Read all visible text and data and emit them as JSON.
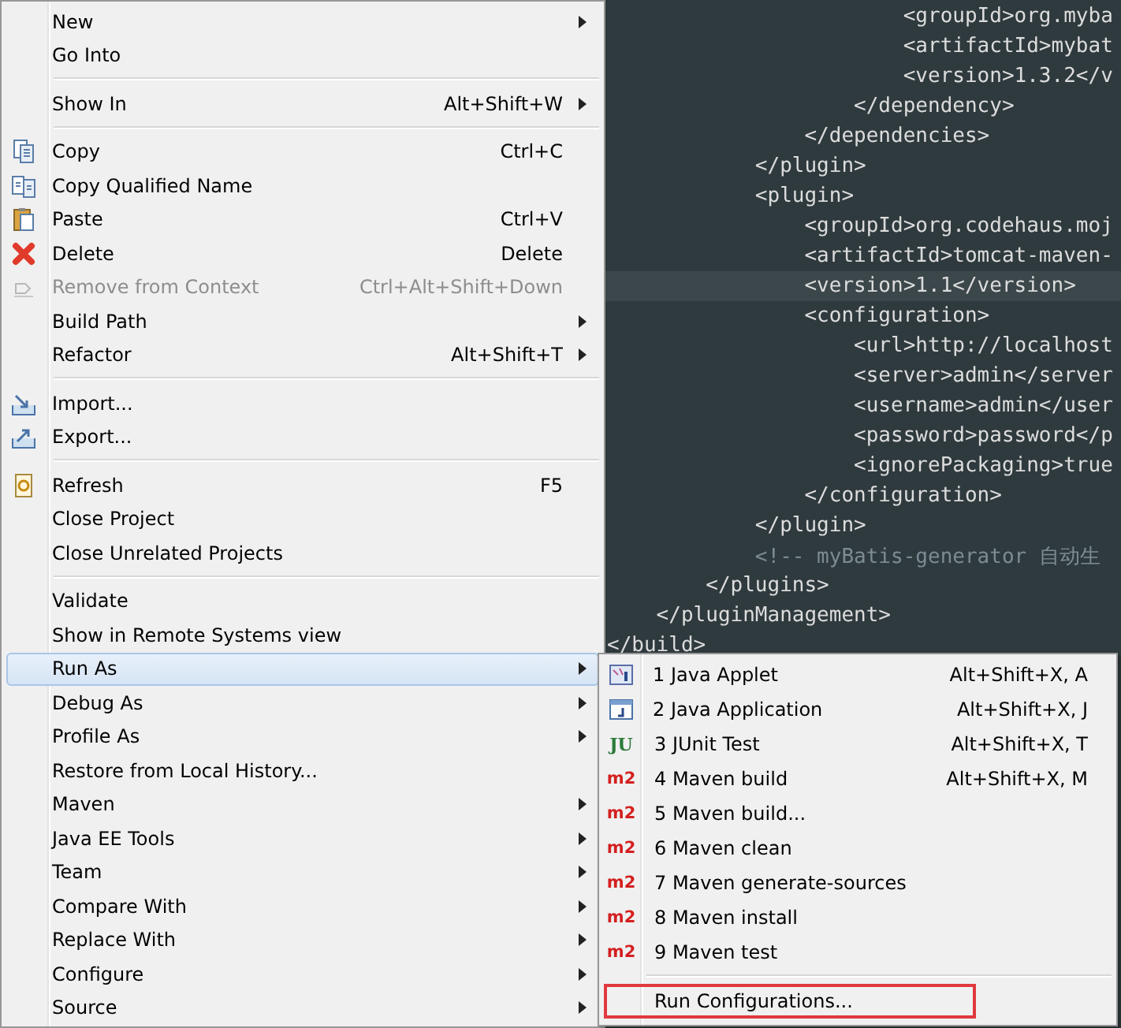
{
  "editor": {
    "lines": [
      {
        "kind": "code",
        "text": "                        <groupId>org.myba",
        "current": false
      },
      {
        "kind": "code",
        "text": "                        <artifactId>mybat",
        "current": false
      },
      {
        "kind": "code",
        "text": "                        <version>1.3.2</v",
        "current": false
      },
      {
        "kind": "code",
        "text": "                    </dependency>",
        "current": false
      },
      {
        "kind": "code",
        "text": "                </dependencies>",
        "current": false
      },
      {
        "kind": "code",
        "text": "            </plugin>",
        "current": false
      },
      {
        "kind": "code",
        "text": "            <plugin>",
        "current": false
      },
      {
        "kind": "code",
        "text": "                <groupId>org.codehaus.moj",
        "current": false
      },
      {
        "kind": "code",
        "text": "                <artifactId>tomcat-maven-",
        "current": false
      },
      {
        "kind": "code",
        "text": "                <version>1.1</version>",
        "current": true
      },
      {
        "kind": "code",
        "text": "                <configuration>",
        "current": false
      },
      {
        "kind": "code",
        "text": "                    <url>http://localhost",
        "current": false
      },
      {
        "kind": "code",
        "text": "                    <server>admin</server",
        "current": false
      },
      {
        "kind": "code",
        "text": "                    <username>admin</user",
        "current": false
      },
      {
        "kind": "code",
        "text": "                    <password>password</p",
        "current": false
      },
      {
        "kind": "code",
        "text": "                    <ignorePackaging>true",
        "current": false
      },
      {
        "kind": "code",
        "text": "                </configuration>",
        "current": false
      },
      {
        "kind": "code",
        "text": "            </plugin>",
        "current": false
      },
      {
        "kind": "comment",
        "text": "            <!-- myBatis-generator 自动生",
        "current": false
      },
      {
        "kind": "code",
        "text": "        </plugins>",
        "current": false
      },
      {
        "kind": "code",
        "text": "    </pluginManagement>",
        "current": false
      },
      {
        "kind": "code",
        "text": "</build>",
        "current": false
      }
    ]
  },
  "context_menu": {
    "groups": [
      [
        {
          "kind": "plain",
          "label": "New",
          "submenu": true,
          "selected": false,
          "disabled": false
        },
        {
          "kind": "plain",
          "label": "Go Into",
          "submenu": false,
          "selected": false,
          "disabled": false
        }
      ],
      [
        {
          "kind": "plain",
          "label": "Show In",
          "shortcut": "Alt+Shift+W",
          "submenu": true,
          "selected": false,
          "disabled": false
        }
      ],
      [
        {
          "kind": "copy",
          "label": "Copy",
          "shortcut": "Ctrl+C",
          "submenu": false,
          "selected": false,
          "disabled": false
        },
        {
          "kind": "copy-qualified",
          "label": "Copy Qualified Name",
          "submenu": false,
          "selected": false,
          "disabled": false
        },
        {
          "kind": "paste",
          "label": "Paste",
          "shortcut": "Ctrl+V",
          "submenu": false,
          "selected": false,
          "disabled": false
        },
        {
          "kind": "delete",
          "label": "Delete",
          "shortcut": "Delete",
          "submenu": false,
          "selected": false,
          "disabled": false
        },
        {
          "kind": "remove",
          "label": "Remove from Context",
          "shortcut": "Ctrl+Alt+Shift+Down",
          "submenu": false,
          "selected": false,
          "disabled": true
        },
        {
          "kind": "plain",
          "label": "Build Path",
          "submenu": true,
          "selected": false,
          "disabled": false
        },
        {
          "kind": "plain",
          "label": "Refactor",
          "shortcut": "Alt+Shift+T",
          "submenu": true,
          "selected": false,
          "disabled": false
        }
      ],
      [
        {
          "kind": "import",
          "label": "Import...",
          "submenu": false,
          "selected": false,
          "disabled": false
        },
        {
          "kind": "export",
          "label": "Export...",
          "submenu": false,
          "selected": false,
          "disabled": false
        }
      ],
      [
        {
          "kind": "refresh",
          "label": "Refresh",
          "shortcut": "F5",
          "submenu": false,
          "selected": false,
          "disabled": false
        },
        {
          "kind": "plain",
          "label": "Close Project",
          "submenu": false,
          "selected": false,
          "disabled": false
        },
        {
          "kind": "plain",
          "label": "Close Unrelated Projects",
          "submenu": false,
          "selected": false,
          "disabled": false
        }
      ],
      [
        {
          "kind": "plain",
          "label": "Validate",
          "submenu": false,
          "selected": false,
          "disabled": false
        },
        {
          "kind": "plain",
          "label": "Show in Remote Systems view",
          "submenu": false,
          "selected": false,
          "disabled": false
        },
        {
          "kind": "plain",
          "label": "Run As",
          "submenu": true,
          "selected": true,
          "disabled": false
        },
        {
          "kind": "plain",
          "label": "Debug As",
          "submenu": true,
          "selected": false,
          "disabled": false
        },
        {
          "kind": "plain",
          "label": "Profile As",
          "submenu": true,
          "selected": false,
          "disabled": false
        },
        {
          "kind": "plain",
          "label": "Restore from Local History...",
          "submenu": false,
          "selected": false,
          "disabled": false
        },
        {
          "kind": "plain",
          "label": "Maven",
          "submenu": true,
          "selected": false,
          "disabled": false
        },
        {
          "kind": "plain",
          "label": "Java EE Tools",
          "submenu": true,
          "selected": false,
          "disabled": false
        },
        {
          "kind": "plain",
          "label": "Team",
          "submenu": true,
          "selected": false,
          "disabled": false
        },
        {
          "kind": "plain",
          "label": "Compare With",
          "submenu": true,
          "selected": false,
          "disabled": false
        },
        {
          "kind": "plain",
          "label": "Replace With",
          "submenu": true,
          "selected": false,
          "disabled": false
        },
        {
          "kind": "plain",
          "label": "Configure",
          "submenu": true,
          "selected": false,
          "disabled": false
        },
        {
          "kind": "plain",
          "label": "Source",
          "submenu": true,
          "selected": false,
          "disabled": false
        }
      ]
    ]
  },
  "run_as_submenu": {
    "groups": [
      [
        {
          "kind": "applet",
          "label": "1 Java Applet",
          "shortcut": "Alt+Shift+X, A",
          "outlined": false
        },
        {
          "kind": "application",
          "label": "2 Java Application",
          "shortcut": "Alt+Shift+X, J",
          "outlined": false
        },
        {
          "kind": "junit",
          "badge": "JU",
          "label": "3 JUnit Test",
          "shortcut": "Alt+Shift+X, T",
          "outlined": false
        },
        {
          "kind": "maven",
          "badge": "m2",
          "label": "4 Maven build",
          "shortcut": "Alt+Shift+X, M",
          "outlined": false
        },
        {
          "kind": "maven",
          "badge": "m2",
          "label": "5 Maven build...",
          "outlined": false
        },
        {
          "kind": "maven",
          "badge": "m2",
          "label": "6 Maven clean",
          "outlined": false
        },
        {
          "kind": "maven",
          "badge": "m2",
          "label": "7 Maven generate-sources",
          "outlined": false
        },
        {
          "kind": "maven",
          "badge": "m2",
          "label": "8 Maven install",
          "outlined": false
        },
        {
          "kind": "maven",
          "badge": "m2",
          "label": "9 Maven test",
          "outlined": false
        }
      ],
      [
        {
          "kind": "plain",
          "label": "Run Configurations...",
          "outlined": true
        }
      ]
    ]
  }
}
